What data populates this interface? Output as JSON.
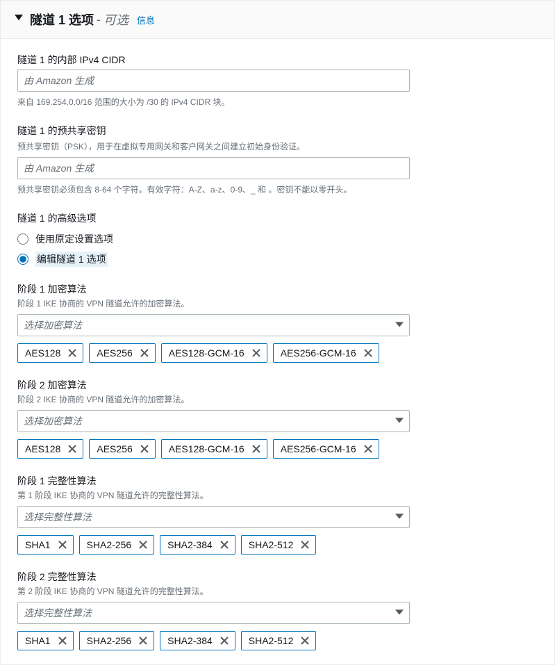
{
  "header": {
    "title": "隧道 1 选项",
    "subtitle": "可选",
    "separator": "-",
    "info_link": "信息"
  },
  "ipv4_cidr": {
    "label": "隧道 1 的内部 IPv4 CIDR",
    "placeholder": "由 Amazon 生成",
    "help": "来自 169.254.0.0/16 范围的大小为 /30 的 IPv4 CIDR 块。"
  },
  "psk": {
    "label": "隧道 1 的预共享密钥",
    "desc": "预共享密钥（PSK），用于在虚拟专用网关和客户网关之间建立初始身份验证。",
    "placeholder": "由 Amazon 生成",
    "help": "预共享密钥必须包含 8-64 个字符。有效字符：A-Z、a-z、0-9、_ 和 。密钥不能以零开头。"
  },
  "advanced": {
    "label": "隧道 1 的高级选项",
    "option_default": "使用原定设置选项",
    "option_edit": "编辑隧道 1 选项"
  },
  "phase1_enc": {
    "label": "阶段 1 加密算法",
    "desc": "阶段 1 IKE 协商的 VPN 隧道允许的加密算法。",
    "placeholder": "选择加密算法",
    "tags": [
      "AES128",
      "AES256",
      "AES128-GCM-16",
      "AES256-GCM-16"
    ]
  },
  "phase2_enc": {
    "label": "阶段 2 加密算法",
    "desc": "阶段 2 IKE 协商的 VPN 隧道允许的加密算法。",
    "placeholder": "选择加密算法",
    "tags": [
      "AES128",
      "AES256",
      "AES128-GCM-16",
      "AES256-GCM-16"
    ]
  },
  "phase1_int": {
    "label": "阶段 1 完整性算法",
    "desc": "第 1 阶段 IKE 协商的 VPN 隧道允许的完整性算法。",
    "placeholder": "选择完整性算法",
    "tags": [
      "SHA1",
      "SHA2-256",
      "SHA2-384",
      "SHA2-512"
    ]
  },
  "phase2_int": {
    "label": "阶段 2 完整性算法",
    "desc": "第 2 阶段 IKE 协商的 VPN 隧道允许的完整性算法。",
    "placeholder": "选择完整性算法",
    "tags": [
      "SHA1",
      "SHA2-256",
      "SHA2-384",
      "SHA2-512"
    ]
  }
}
